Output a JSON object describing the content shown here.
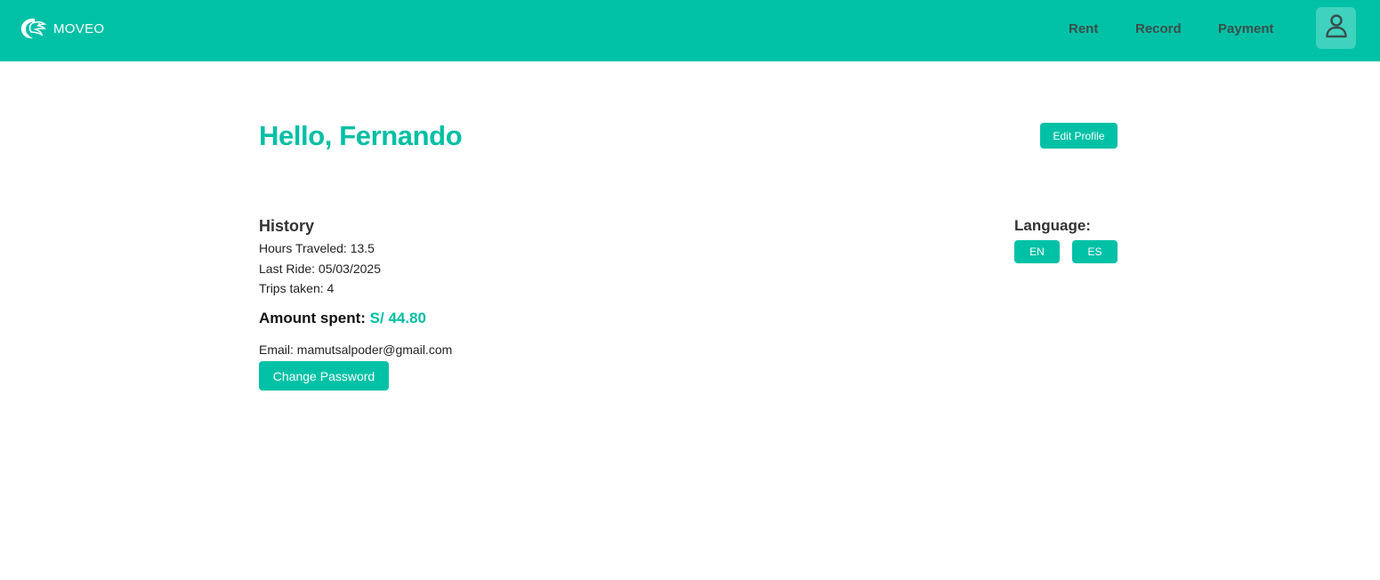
{
  "header": {
    "brand_name": "MOVEO",
    "logo_icon": "dragon-logo-icon",
    "nav": {
      "rent": "Rent",
      "record": "Record",
      "payment": "Payment"
    },
    "user_icon": "user-icon"
  },
  "main": {
    "greeting": "Hello, Fernando",
    "edit_profile_label": "Edit Profile",
    "history": {
      "title": "History",
      "hours_traveled": "Hours Traveled: 13.5",
      "last_ride": "Last Ride: 05/03/2025",
      "trips_taken": "Trips taken: 4"
    },
    "amount_label": "Amount spent:",
    "amount_value": "S/ 44.80",
    "email": "Email: mamutsalpoder@gmail.com",
    "change_password_label": "Change Password",
    "language": {
      "title": "Language:",
      "en_label": "EN",
      "es_label": "ES"
    }
  },
  "colors": {
    "brand": "#00c1a6",
    "accent_text": "#00bfa5",
    "user_button_bg": "#3fd3bf",
    "nav_text": "#3a4f4c"
  }
}
